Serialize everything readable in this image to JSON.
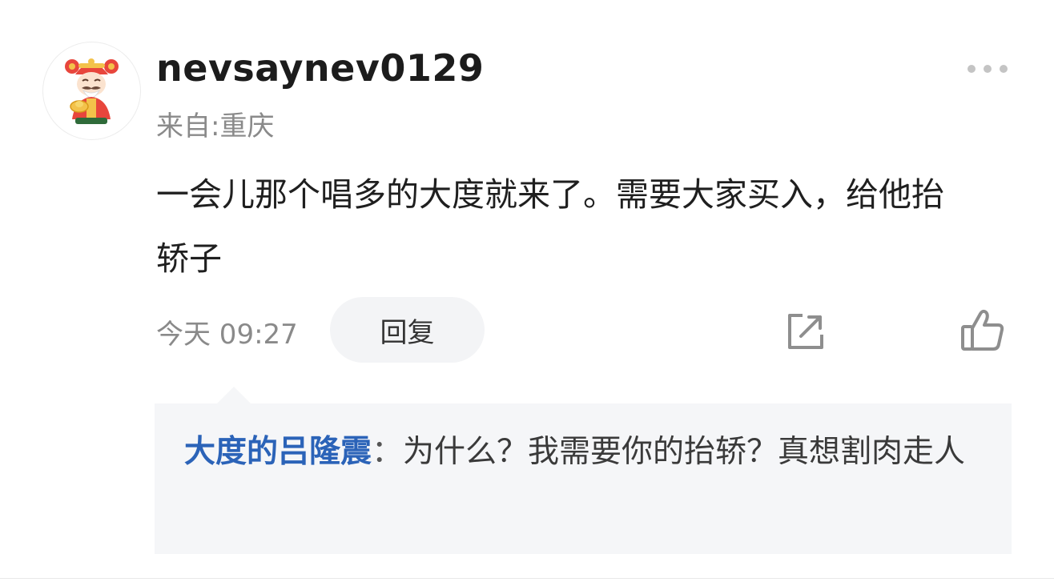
{
  "comment": {
    "username": "nevsaynev0129",
    "location": "来自:重庆",
    "text": "一会儿那个唱多的大度就来了。需要大家买入，给他抬轿子",
    "timestamp": "今天 09:27",
    "reply_label": "回复",
    "avatar_icon": "god-of-wealth-avatar",
    "more_icon": "more-dots-icon",
    "share_icon": "share-icon",
    "like_icon": "thumbs-up-icon"
  },
  "reply": {
    "author": "大度的吕隆震",
    "separator": "：",
    "text": "为什么？我需要你的抬轿？真想割肉走人"
  },
  "colors": {
    "accent": "#2b63b8",
    "muted_text": "#8a8a8a",
    "reply_bg": "#f5f6f8",
    "button_bg": "#f3f4f6"
  }
}
